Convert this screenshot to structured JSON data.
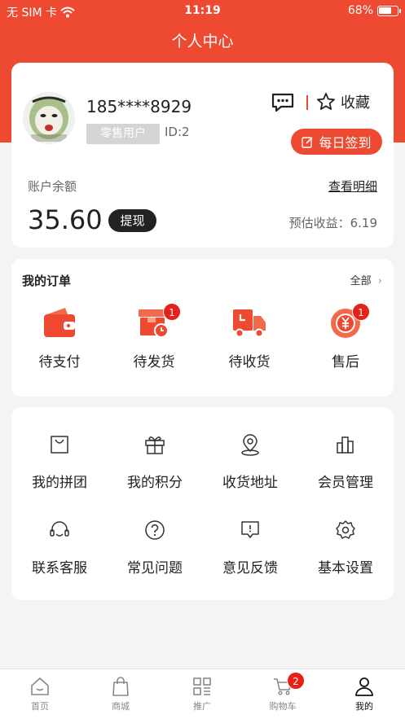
{
  "status_bar": {
    "carrier": "无 SIM 卡",
    "time": "11:19",
    "battery": "68%"
  },
  "header": {
    "title": "个人中心"
  },
  "profile": {
    "phone": "185****8929",
    "role": "零售用户",
    "user_id": "ID:2",
    "favorites_label": "收藏",
    "signin_label": "每日签到",
    "balance_label": "账户余额",
    "detail_link": "查看明细",
    "balance": "35.60",
    "withdraw_label": "提现",
    "estimated_label": "预估收益：6.19"
  },
  "orders": {
    "title": "我的订单",
    "all_label": "全部",
    "items": [
      {
        "label": "待支付",
        "icon": "wallet-icon"
      },
      {
        "label": "待发货",
        "icon": "package-clock-icon",
        "badge": "1"
      },
      {
        "label": "待收货",
        "icon": "truck-icon"
      },
      {
        "label": "售后",
        "icon": "yen-coin-icon",
        "badge": "1"
      }
    ]
  },
  "tools": {
    "items": [
      {
        "label": "我的拼团",
        "icon": "bag-icon"
      },
      {
        "label": "我的积分",
        "icon": "gift-icon"
      },
      {
        "label": "收货地址",
        "icon": "location-icon"
      },
      {
        "label": "会员管理",
        "icon": "bar-chart-icon"
      },
      {
        "label": "联系客服",
        "icon": "headset-icon"
      },
      {
        "label": "常见问题",
        "icon": "question-icon"
      },
      {
        "label": "意见反馈",
        "icon": "feedback-icon"
      },
      {
        "label": "基本设置",
        "icon": "settings-icon"
      }
    ]
  },
  "tabbar": {
    "items": [
      {
        "label": "首页",
        "icon": "home-icon"
      },
      {
        "label": "商城",
        "icon": "shop-bag-icon"
      },
      {
        "label": "推广",
        "icon": "grid-icon"
      },
      {
        "label": "购物车",
        "icon": "cart-icon",
        "badge": "2"
      },
      {
        "label": "我的",
        "icon": "user-icon",
        "active": true
      }
    ]
  },
  "colors": {
    "brand": "#ee4a31",
    "badge": "#e5211a"
  }
}
